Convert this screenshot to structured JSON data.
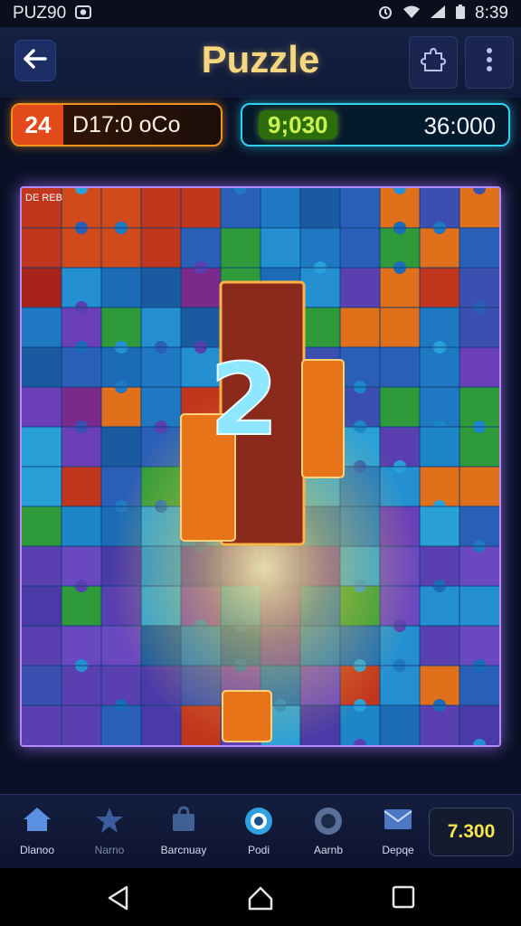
{
  "status_bar": {
    "app_label": "PUZ90",
    "time": "8:39"
  },
  "header": {
    "title": "Puzzle"
  },
  "score": {
    "level": "24",
    "left_text": "D17:0 oCo",
    "highlight": "9;030",
    "right_value": "36:000"
  },
  "board": {
    "corner_text": "DE REB",
    "center_number": "2"
  },
  "bottom_nav": {
    "items": [
      {
        "label": "Dlanoo",
        "icon": "home-icon"
      },
      {
        "label": "Narno",
        "icon": "star-icon"
      },
      {
        "label": "Barcnuay",
        "icon": "bag-icon"
      },
      {
        "label": "Podi",
        "icon": "target-icon"
      },
      {
        "label": "Aarnb",
        "icon": "disc-icon"
      },
      {
        "label": "Depqe",
        "icon": "mail-icon"
      }
    ],
    "coins": "7.300"
  },
  "colors": {
    "accent_orange": "#f0921b",
    "accent_cyan": "#2fd0f0",
    "board_border": "#b28cff",
    "title_gold": "#f4d77e"
  }
}
